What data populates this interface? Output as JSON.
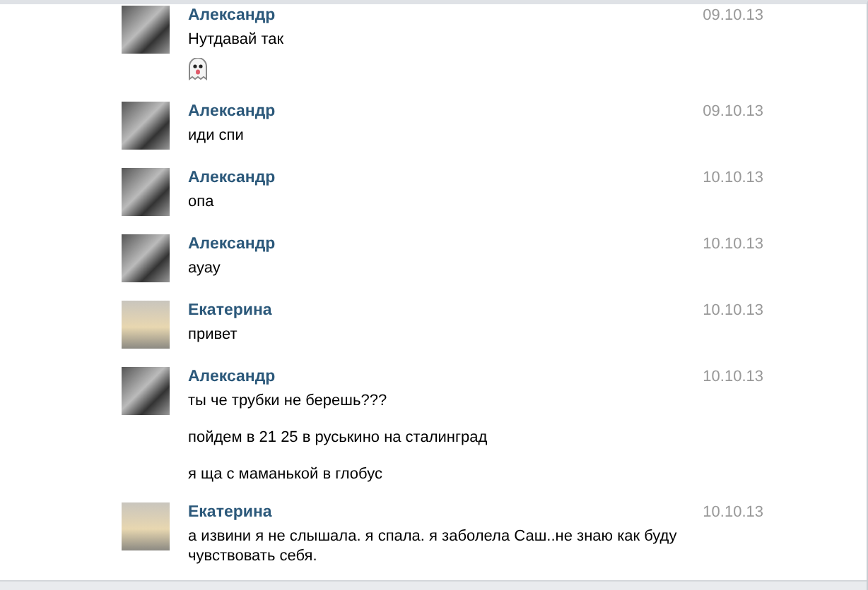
{
  "messages": [
    {
      "sender": "Александр",
      "date": "09.10.13",
      "avatar": {
        "kind": "group"
      },
      "lines": [
        {
          "kind": "text",
          "text": "Нутдавай так"
        },
        {
          "kind": "emoji"
        }
      ]
    },
    {
      "sender": "Александр",
      "date": "09.10.13",
      "avatar": {
        "kind": "group"
      },
      "lines": [
        {
          "kind": "text",
          "text": "иди спи"
        }
      ]
    },
    {
      "sender": "Александр",
      "date": "10.10.13",
      "avatar": {
        "kind": "group"
      },
      "lines": [
        {
          "kind": "text",
          "text": "опа"
        }
      ]
    },
    {
      "sender": "Александр",
      "date": "10.10.13",
      "avatar": {
        "kind": "group"
      },
      "lines": [
        {
          "kind": "text",
          "text": "ауау"
        }
      ]
    },
    {
      "sender": "Екатерина",
      "date": "10.10.13",
      "avatar": {
        "kind": "beach"
      },
      "lines": [
        {
          "kind": "text",
          "text": "привет"
        }
      ]
    },
    {
      "sender": "Александр",
      "date": "10.10.13",
      "avatar": {
        "kind": "group"
      },
      "lines": [
        {
          "kind": "text",
          "text": "ты че трубки не берешь???"
        },
        {
          "kind": "text",
          "text": "пойдем в 21 25 в руськино на сталинград"
        },
        {
          "kind": "text",
          "text": "я ща с маманькой в глобус"
        }
      ]
    },
    {
      "sender": "Екатерина",
      "date": "10.10.13",
      "avatar": {
        "kind": "beach"
      },
      "lines": [
        {
          "kind": "text",
          "text": "а извини я не слышала. я спала. я заболела Саш..не знаю как буду чувствовать себя."
        }
      ]
    }
  ]
}
